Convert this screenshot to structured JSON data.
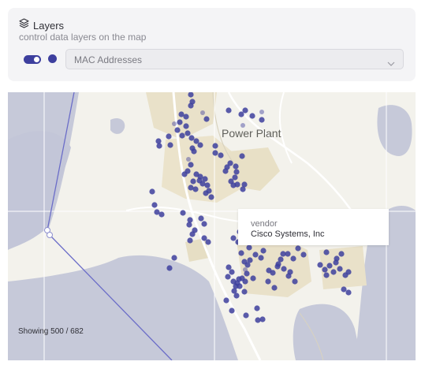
{
  "layers_panel": {
    "title": "Layers",
    "subtitle": "control data layers on the map",
    "layer": {
      "enabled": true,
      "color": "#3d3f9e",
      "selected_value": "MAC Addresses"
    },
    "icons": {
      "title": "layers-icon",
      "select": "chevron-down-icon"
    }
  },
  "map": {
    "place_label": "Power Plant",
    "point_color": "#3d3f9e",
    "tooltip": {
      "key": "vendor",
      "value": "Cisco Systems, Inc"
    },
    "status": "Showing 500 / 682"
  }
}
